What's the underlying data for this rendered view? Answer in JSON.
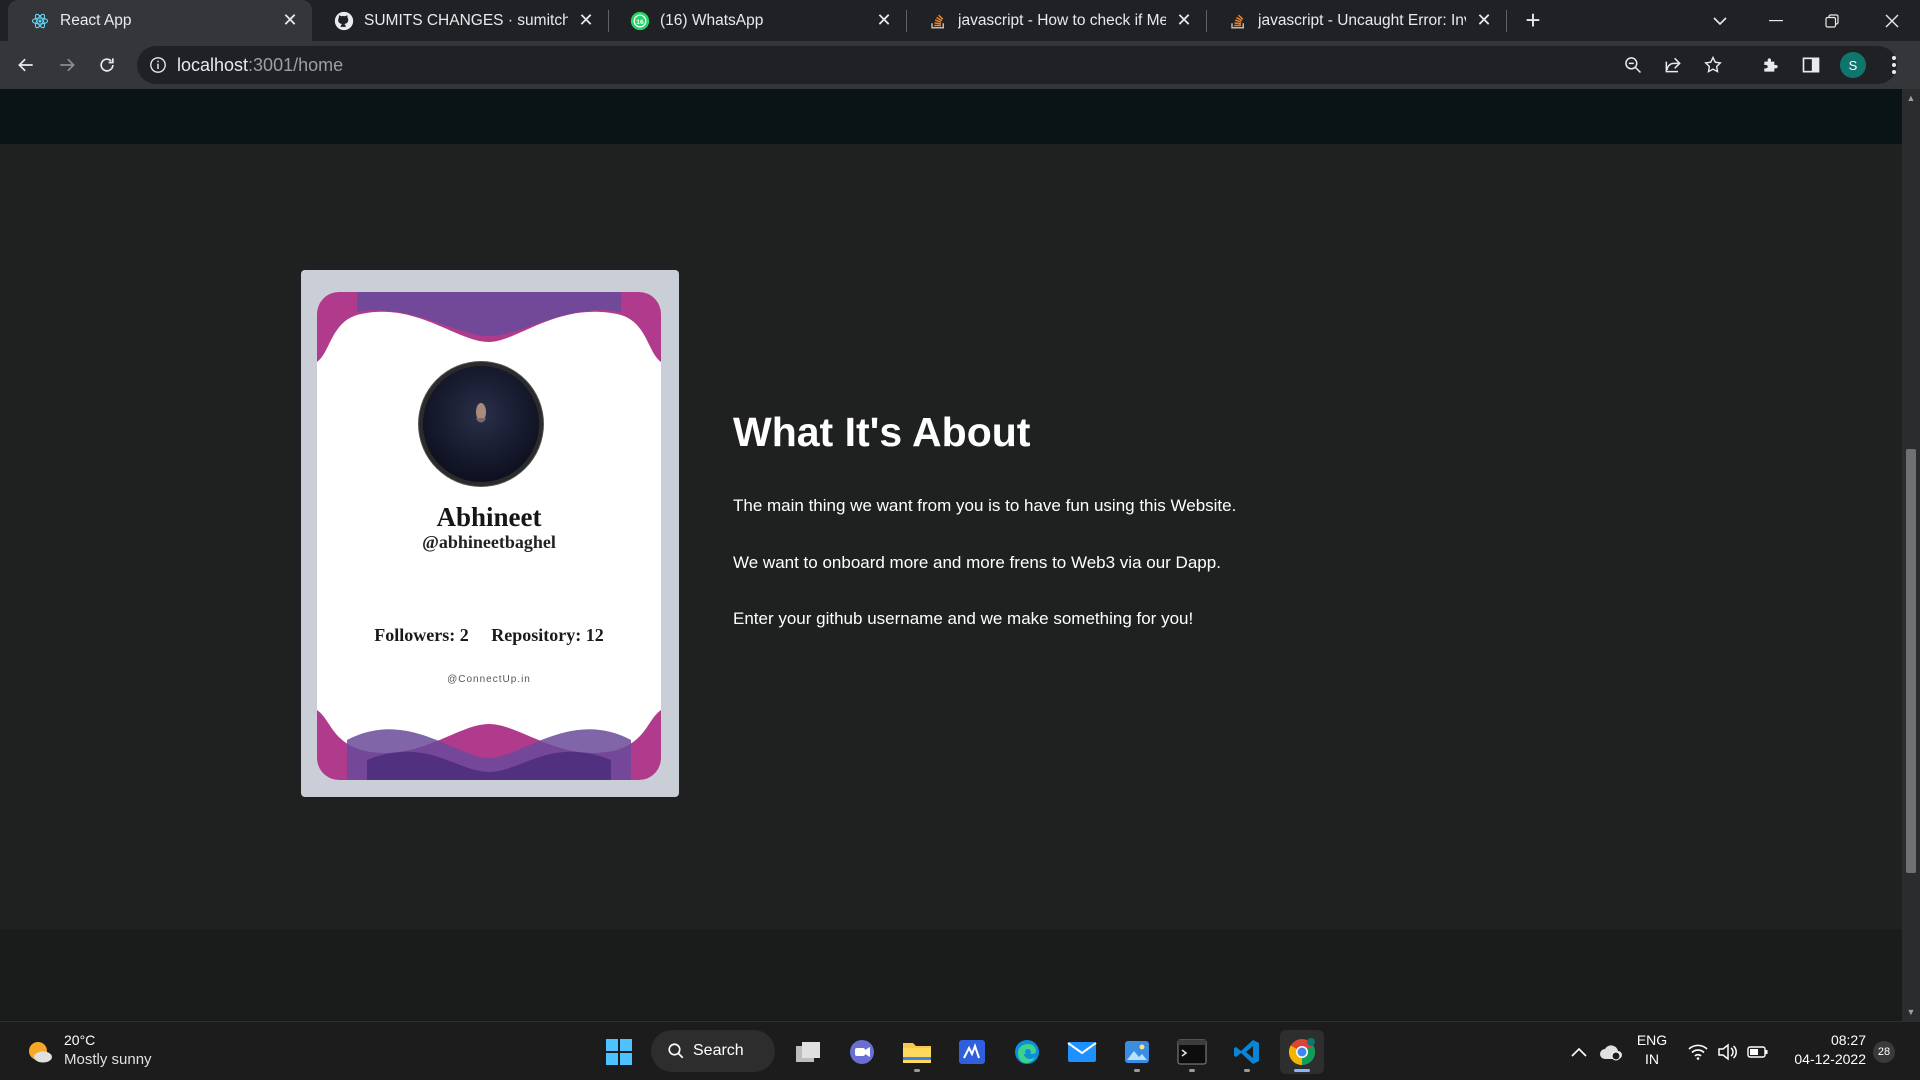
{
  "browser": {
    "tabs": [
      {
        "title": "React App",
        "icon": "react-icon",
        "active": true
      },
      {
        "title": "SUMITS CHANGES · sumitchoudh",
        "icon": "github-icon",
        "active": false
      },
      {
        "title": "(16) WhatsApp",
        "icon": "whatsapp-icon",
        "badge": "16",
        "active": false
      },
      {
        "title": "javascript - How to check if Meta",
        "icon": "stackoverflow-icon",
        "active": false
      },
      {
        "title": "javascript - Uncaught Error: Invar",
        "icon": "stackoverflow-icon",
        "active": false
      }
    ],
    "address": {
      "host": "localhost",
      "path": ":3001/home"
    },
    "profile_initial": "S"
  },
  "card": {
    "name": "Abhineet",
    "handle": "@abhineetbaghel",
    "stats": "Followers: 2     Repository: 12",
    "brand": "@ConnectUp.in"
  },
  "about": {
    "title": "What It's About",
    "paragraphs": [
      "The main thing we want from you is to have fun using this Website.",
      "We want to onboard more and more frens to Web3 via our Dapp.",
      "Enter your github username and we make something for you!"
    ]
  },
  "taskbar": {
    "weather": {
      "temp": "20°C",
      "desc": "Mostly sunny"
    },
    "search_label": "Search",
    "language": {
      "line1": "ENG",
      "line2": "IN"
    },
    "time": "08:27",
    "date": "04-12-2022",
    "notifications": "28"
  },
  "colors": {
    "page_bg": "#1f2121",
    "card_wave_pink": "#b03a8c",
    "card_wave_purple": "#6b4a9a"
  }
}
